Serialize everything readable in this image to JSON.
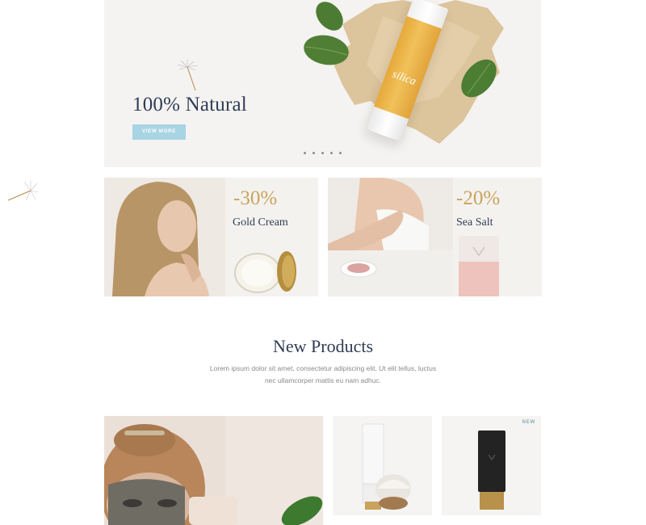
{
  "hero": {
    "title": "100% Natural",
    "button_label": "VIEW MORE",
    "product_brand": "silica",
    "slide_count": 5
  },
  "promos": [
    {
      "discount": "-30%",
      "label": "Gold Cream"
    },
    {
      "discount": "-20%",
      "label": "Sea Salt"
    }
  ],
  "new_products": {
    "title": "New Products",
    "description_line1": "Lorem ipsum dolor sit amet, consectetur adipiscing elit. Ut elit tellus, luctus",
    "description_line2": "nec ullamcorper mattis eu nam adhuc.",
    "products": [
      {
        "badge": ""
      },
      {
        "badge": "NEW"
      }
    ]
  },
  "colors": {
    "title_navy": "#2f3d55",
    "gold": "#c9a35c",
    "button_blue": "#a9d4e4",
    "panel_bg": "#f4f3f1"
  },
  "icons": [
    "dandelion-icon",
    "slider-dot-icon"
  ]
}
